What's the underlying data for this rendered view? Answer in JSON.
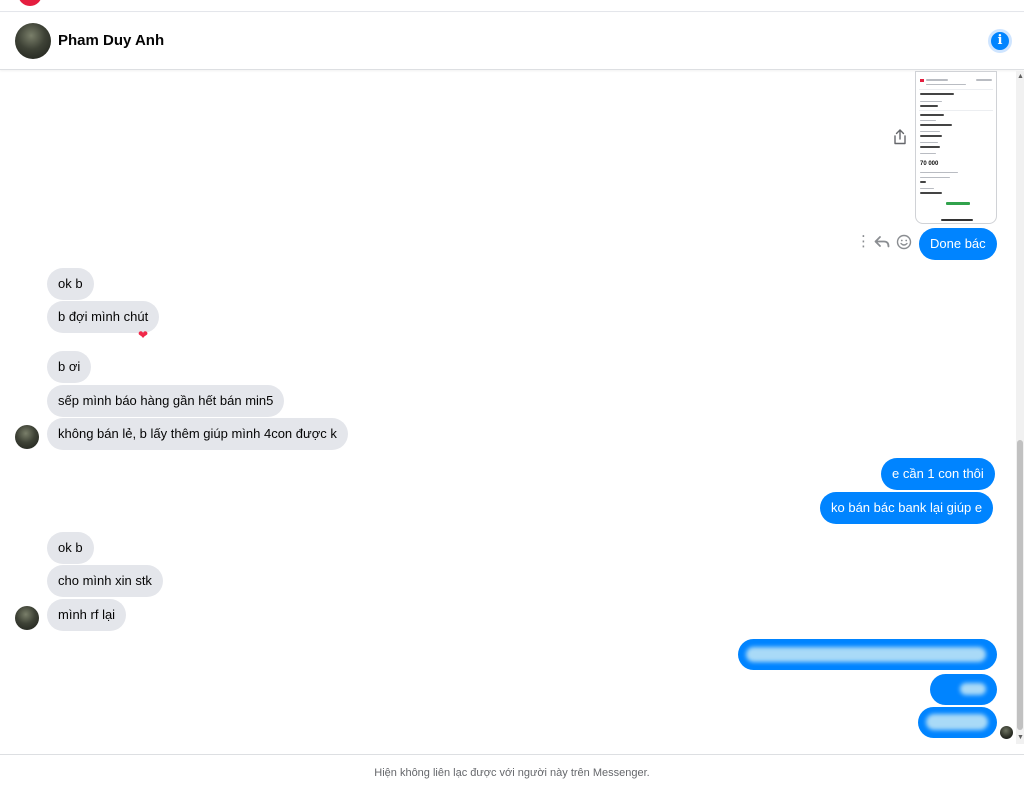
{
  "header": {
    "contact_name": "Pham Duy Anh",
    "info_icon": "info-icon"
  },
  "colors": {
    "outgoing_bubble": "#0084ff",
    "incoming_bubble": "#e4e6eb",
    "reaction_heart": "#f02849"
  },
  "shared_image": {
    "amount": "70 000"
  },
  "messages": {
    "m1": "Done bác",
    "m2": "ok b",
    "m3": "b đợi mình chút",
    "m4": "b ơi",
    "m5": "sếp mình báo hàng gần hết bán min5",
    "m6": "không bán lẻ, b lấy thêm giúp mình 4con được k",
    "m7": "e cần 1 con thôi",
    "m8": "ko bán bác bank lại giúp e",
    "m9": "ok b",
    "m10": "cho mình xin stk",
    "m11": "mình rf lại"
  },
  "reactions": {
    "m3": "❤"
  },
  "footer": {
    "notice": "Hiện không liên lạc được với người này trên Messenger."
  }
}
